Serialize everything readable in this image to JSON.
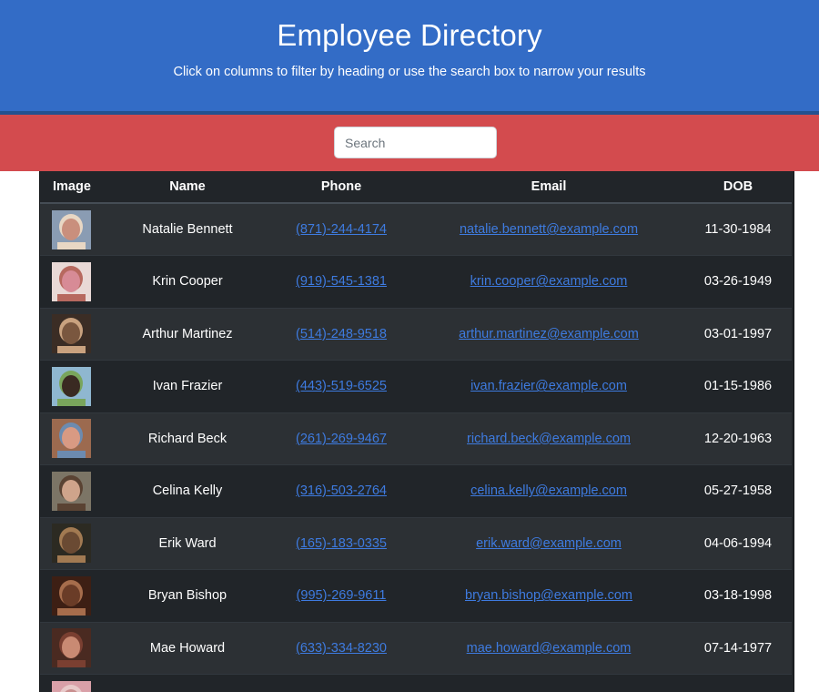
{
  "header": {
    "title": "Employee Directory",
    "subtitle": "Click on columns to filter by heading or use the search box to narrow your results"
  },
  "search": {
    "placeholder": "Search",
    "value": ""
  },
  "table": {
    "columns": [
      "Image",
      "Name",
      "Phone",
      "Email",
      "DOB"
    ],
    "rows": [
      {
        "name": "Natalie Bennett",
        "phone": "(871)-244-4174",
        "email": "natalie.bennett@example.com",
        "dob": "11-30-1984",
        "avatar_colors": [
          "#8a9cb3",
          "#c98f7d",
          "#e8d7c4"
        ]
      },
      {
        "name": "Krin Cooper",
        "phone": "(919)-545-1381",
        "email": "krin.cooper@example.com",
        "dob": "03-26-1949",
        "avatar_colors": [
          "#e9d9d6",
          "#d78b96",
          "#b7695f"
        ]
      },
      {
        "name": "Arthur Martinez",
        "phone": "(514)-248-9518",
        "email": "arthur.martinez@example.com",
        "dob": "03-01-1997",
        "avatar_colors": [
          "#3b2d25",
          "#7a573f",
          "#c9a27f"
        ]
      },
      {
        "name": "Ivan Frazier",
        "phone": "(443)-519-6525",
        "email": "ivan.frazier@example.com",
        "dob": "01-15-1986",
        "avatar_colors": [
          "#8fb7d0",
          "#3a2a22",
          "#79a55c"
        ]
      },
      {
        "name": "Richard Beck",
        "phone": "(261)-269-9467",
        "email": "richard.beck@example.com",
        "dob": "12-20-1963",
        "avatar_colors": [
          "#9c6a4f",
          "#d99a83",
          "#6c8bb0"
        ]
      },
      {
        "name": "Celina Kelly",
        "phone": "(316)-503-2764",
        "email": "celina.kelly@example.com",
        "dob": "05-27-1958",
        "avatar_colors": [
          "#7c7566",
          "#cfa48b",
          "#5a4333"
        ]
      },
      {
        "name": "Erik Ward",
        "phone": "(165)-183-0335",
        "email": "erik.ward@example.com",
        "dob": "04-06-1994",
        "avatar_colors": [
          "#2c2a22",
          "#6a4a33",
          "#a27a52"
        ]
      },
      {
        "name": "Bryan Bishop",
        "phone": "(995)-269-9611",
        "email": "bryan.bishop@example.com",
        "dob": "03-18-1998",
        "avatar_colors": [
          "#3d1f14",
          "#6a3c27",
          "#a66d4c"
        ]
      },
      {
        "name": "Mae Howard",
        "phone": "(633)-334-8230",
        "email": "mae.howard@example.com",
        "dob": "07-14-1977",
        "avatar_colors": [
          "#4a2a21",
          "#c98a73",
          "#7a3f31"
        ]
      },
      {
        "name": "",
        "phone": "",
        "email": "",
        "dob": "",
        "avatar_colors": [
          "#d9a0a8",
          "#c98f8f",
          "#e8c9c9"
        ]
      }
    ]
  },
  "colors": {
    "header_bg": "#336cc6",
    "search_bar_bg": "#d34b4e",
    "table_dark": "#212529",
    "table_stripe": "#2c3034",
    "link": "#3e7be0"
  }
}
